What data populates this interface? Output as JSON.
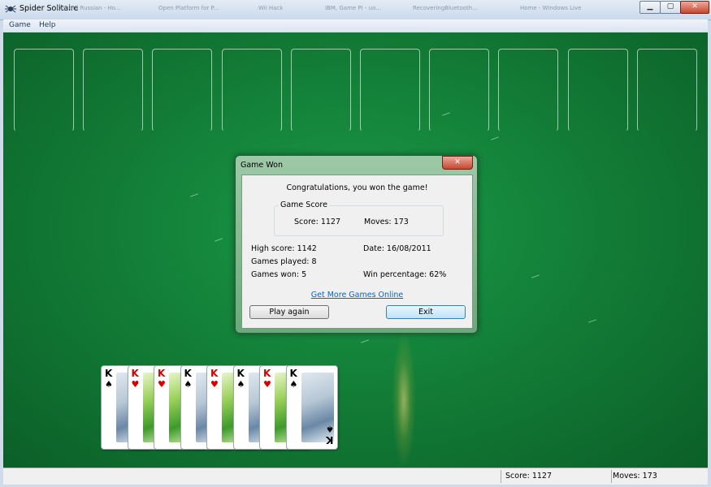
{
  "window": {
    "title": "Spider Solitaire",
    "background_tabs": [
      "Discord Russian - Ho...",
      "Open Platform for P...",
      "Wii Hack",
      "IBM, Game PI - uo...",
      "RecoveringBluetooth...",
      "Home - Windows Live"
    ]
  },
  "menu": {
    "game": "Game",
    "help": "Help"
  },
  "completed_stacks": [
    {
      "rank": "K",
      "suit": "♠",
      "color": "black",
      "art": "snow"
    },
    {
      "rank": "K",
      "suit": "♥",
      "color": "red",
      "art": "leaf"
    },
    {
      "rank": "K",
      "suit": "♥",
      "color": "red",
      "art": "leaf"
    },
    {
      "rank": "K",
      "suit": "♠",
      "color": "black",
      "art": "snow"
    },
    {
      "rank": "K",
      "suit": "♥",
      "color": "red",
      "art": "leaf"
    },
    {
      "rank": "K",
      "suit": "♠",
      "color": "black",
      "art": "snow"
    },
    {
      "rank": "K",
      "suit": "♥",
      "color": "red",
      "art": "leaf"
    },
    {
      "rank": "K",
      "suit": "♠",
      "color": "black",
      "art": "snow"
    }
  ],
  "status": {
    "score": "Score: 1127",
    "moves": "Moves:  173"
  },
  "dialog": {
    "title": "Game Won",
    "message": "Congratulations, you won the game!",
    "score_group_label": "Game Score",
    "score": "Score: 1127",
    "moves": "Moves: 173",
    "high_score": "High score: 1142",
    "date": "Date: 16/08/2011",
    "games_played": "Games played: 8",
    "games_won": "Games won: 5",
    "win_percentage": "Win percentage: 62%",
    "more_games_link": "Get More Games Online",
    "play_again_button": "Play again",
    "exit_button": "Exit"
  }
}
